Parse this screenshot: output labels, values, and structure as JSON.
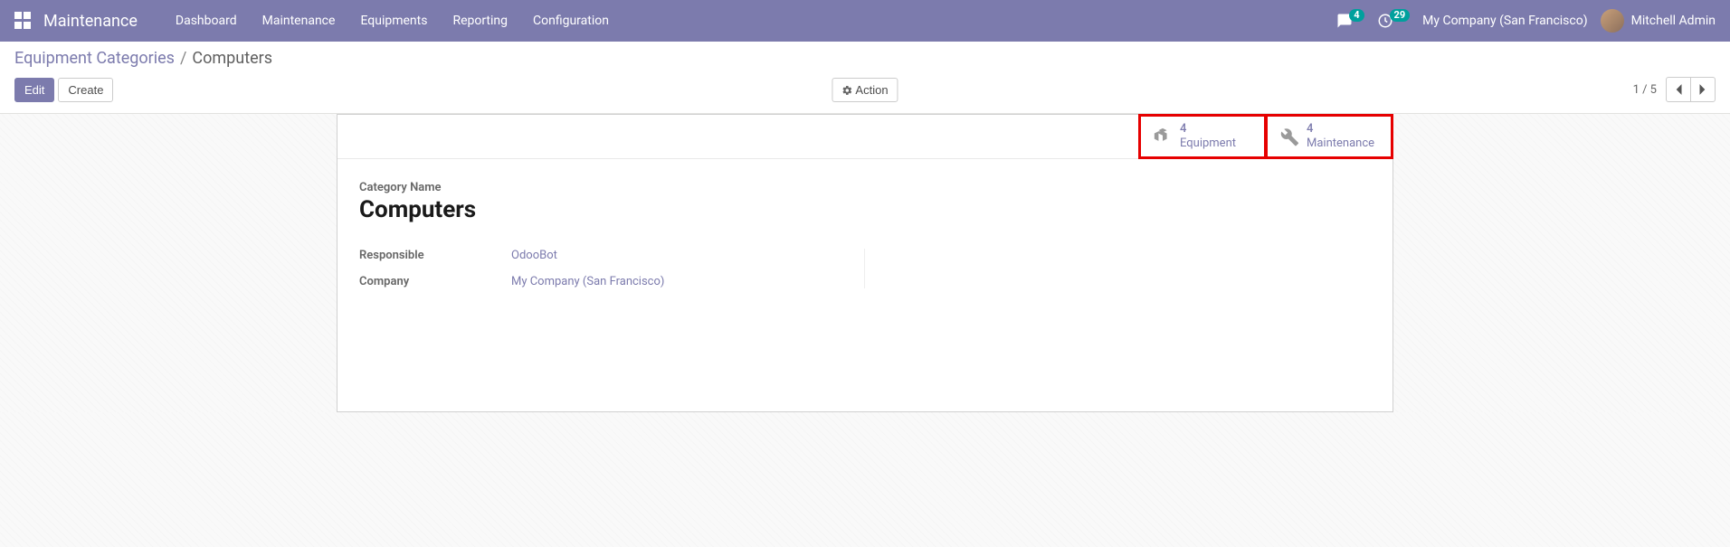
{
  "topnav": {
    "brand": "Maintenance",
    "menu": [
      "Dashboard",
      "Maintenance",
      "Equipments",
      "Reporting",
      "Configuration"
    ],
    "messages_badge": "4",
    "activities_badge": "29",
    "company": "My Company (San Francisco)",
    "user": "Mitchell Admin"
  },
  "breadcrumb": {
    "parent": "Equipment Categories",
    "current": "Computers"
  },
  "buttons": {
    "edit": "Edit",
    "create": "Create",
    "action": "Action"
  },
  "pager": {
    "position": "1 / 5"
  },
  "stat_buttons": {
    "equipment": {
      "count": "4",
      "label": "Equipment"
    },
    "maintenance": {
      "count": "4",
      "label": "Maintenance"
    }
  },
  "form": {
    "category_name_label": "Category Name",
    "category_name": "Computers",
    "responsible_label": "Responsible",
    "responsible": "OdooBot",
    "company_label": "Company",
    "company": "My Company (San Francisco)"
  }
}
